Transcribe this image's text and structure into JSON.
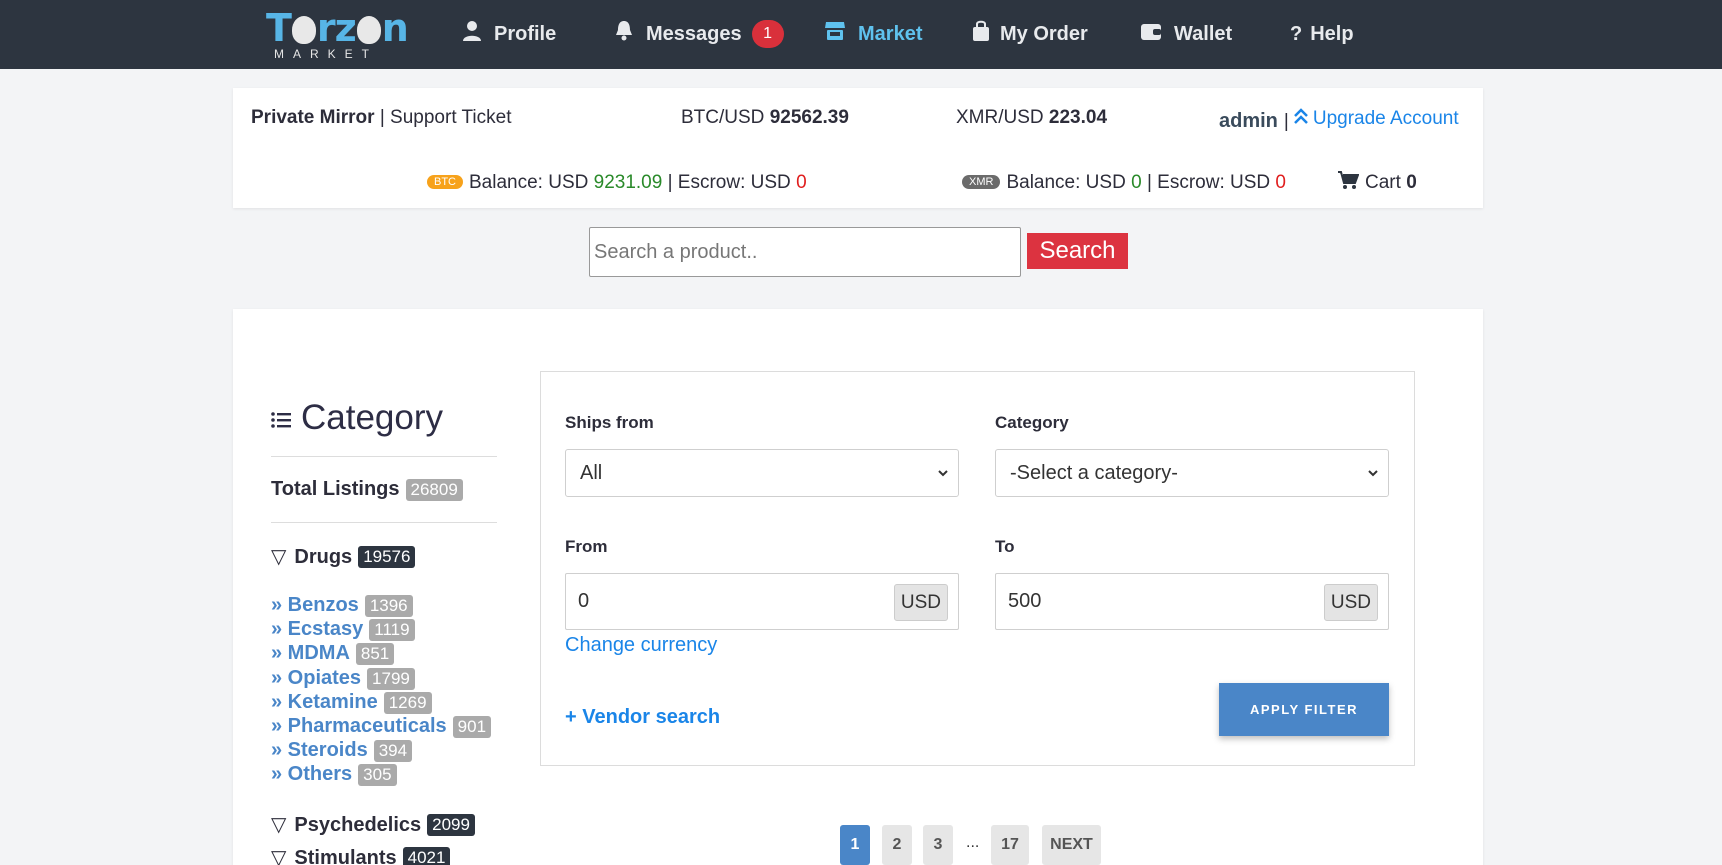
{
  "nav": {
    "logo_top": "Torzon",
    "logo_bottom": "MARKET",
    "items": [
      {
        "label": "Profile",
        "icon": "user-icon"
      },
      {
        "label": "Messages",
        "icon": "bell-icon",
        "badge": "1"
      },
      {
        "label": "Market",
        "icon": "store-icon",
        "active": true
      },
      {
        "label": "My Order",
        "icon": "bag-icon"
      },
      {
        "label": "Wallet",
        "icon": "wallet-icon"
      },
      {
        "label": "Help",
        "icon": "question-icon"
      }
    ]
  },
  "info": {
    "private_mirror": "Private Mirror",
    "separator": "|",
    "support_ticket": "Support Ticket",
    "btc_usd_label": "BTC/USD",
    "btc_usd_value": "92562.39",
    "xmr_usd_label": "XMR/USD",
    "xmr_usd_value": "223.04",
    "username": "admin",
    "upgrade_account": "Upgrade Account",
    "btc_pill": "BTC",
    "btc_balance_label": "Balance: USD",
    "btc_balance_value": "9231.09",
    "btc_escrow_label": "| Escrow: USD",
    "btc_escrow_value": "0",
    "xmr_pill": "XMR",
    "xmr_balance_label": "Balance: USD",
    "xmr_balance_value": "0",
    "xmr_escrow_label": "| Escrow: USD",
    "xmr_escrow_value": "0",
    "cart_label": "Cart",
    "cart_count": "0"
  },
  "search": {
    "placeholder": "Search a product..",
    "button": "Search"
  },
  "sidebar": {
    "title": "Category",
    "total_label": "Total Listings",
    "total_count": "26809",
    "groups": [
      {
        "label": "Drugs",
        "count": "19576"
      },
      {
        "label": "Psychedelics",
        "count": "2099"
      },
      {
        "label": "Stimulants",
        "count": "4021"
      }
    ],
    "sub_items": [
      {
        "label": "» Benzos",
        "count": "1396"
      },
      {
        "label": "» Ecstasy",
        "count": "1119"
      },
      {
        "label": "» MDMA",
        "count": "851"
      },
      {
        "label": "» Opiates",
        "count": "1799"
      },
      {
        "label": "» Ketamine",
        "count": "1269"
      },
      {
        "label": "» Pharmaceuticals",
        "count": "901"
      },
      {
        "label": "» Steroids",
        "count": "394"
      },
      {
        "label": "» Others",
        "count": "305"
      }
    ]
  },
  "filter": {
    "ships_from_label": "Ships from",
    "ships_from_value": "All",
    "category_label": "Category",
    "category_value": "-Select a category-",
    "from_label": "From",
    "from_value": "0",
    "to_label": "To",
    "to_value": "500",
    "currency": "USD",
    "change_currency": "Change currency",
    "vendor_search": "+ Vendor search",
    "apply": "APPLY FILTER"
  },
  "pagination": {
    "pages": [
      "1",
      "2",
      "3",
      "17"
    ],
    "ellipsis": "...",
    "next": "NEXT",
    "current": "1"
  },
  "colors": {
    "navbar": "#2d3540",
    "accent": "#5fc2ee",
    "link": "#1a85e8",
    "button_red": "#dc3340",
    "apply_blue": "#4a86c8"
  }
}
